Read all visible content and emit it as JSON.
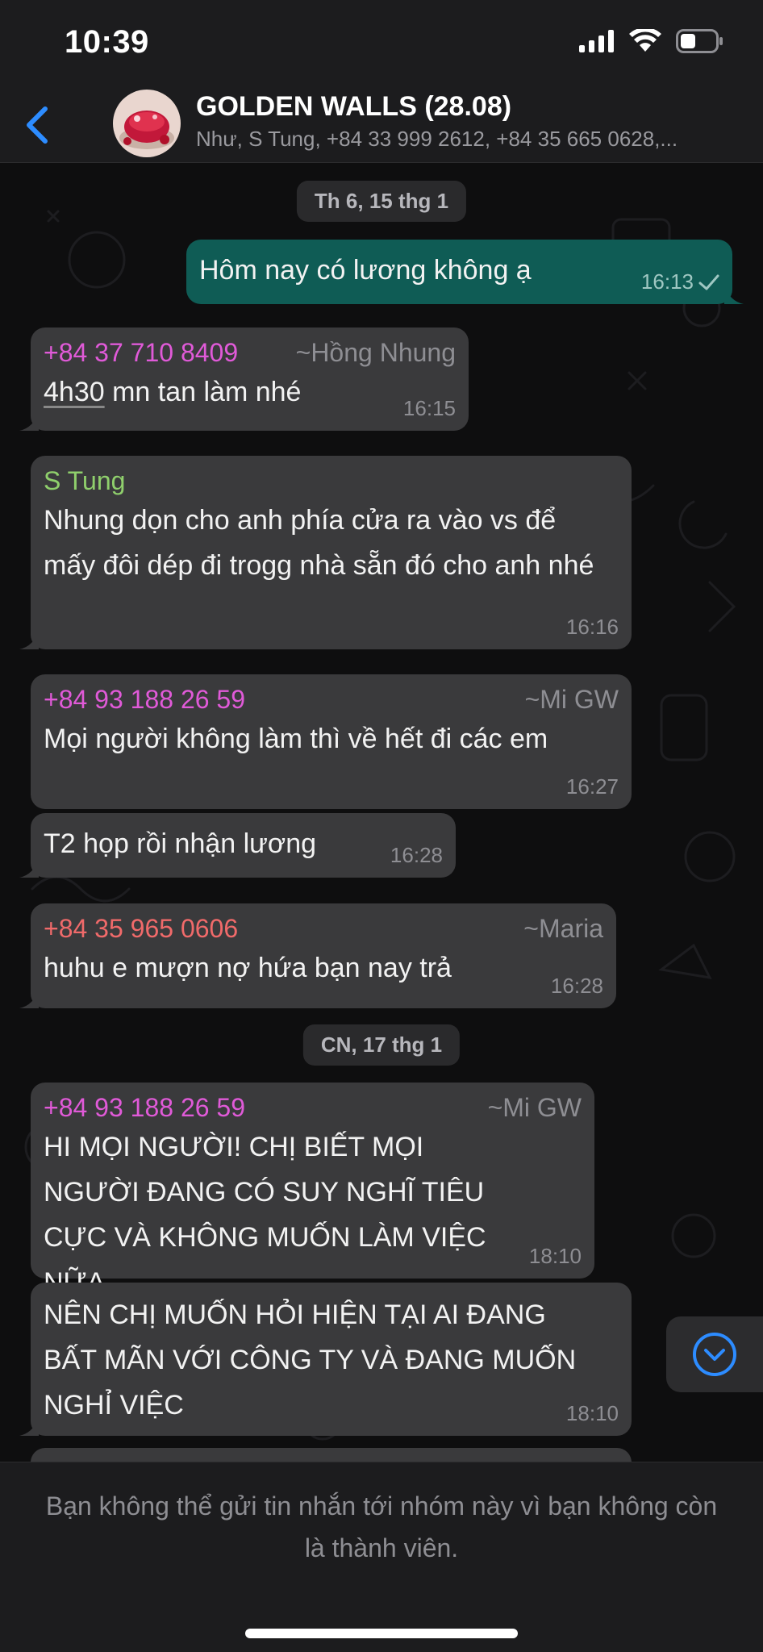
{
  "status_bar": {
    "time": "10:39"
  },
  "header": {
    "title": "GOLDEN WALLS (28.08)",
    "members": "Như, S Tung, +84 33 999 2612, +84 35 665 0628,..."
  },
  "dates": [
    "Th 6, 15 thg 1",
    "CN, 17 thg 1"
  ],
  "messages": [
    {
      "direction": "out",
      "text": "Hôm nay có lương không ạ",
      "time": "16:13",
      "status_icon": "sent-check-icon"
    },
    {
      "direction": "in",
      "sender": "+84 37 710 8409",
      "pushname": "~Hồng Nhung",
      "sender_color": "#e05ad8",
      "text_u": "4h30",
      "text": " mn tan làm nhé",
      "time": "16:15"
    },
    {
      "direction": "in",
      "sender": "S Tung",
      "sender_color": "#8fcf6c",
      "text": "Nhung dọn cho anh phía cửa ra vào vs để mấy đôi dép đi trogg nhà sẵn đó cho anh nhé",
      "time": "16:16"
    },
    {
      "direction": "in",
      "sender": "+84 93 188 26 59",
      "pushname": "~Mi GW",
      "sender_color": "#e05ad8",
      "text": "Mọi người không làm thì về hết đi các em",
      "time": "16:27"
    },
    {
      "direction": "in",
      "text": "T2 họp rồi nhận lương",
      "time": "16:28"
    },
    {
      "direction": "in",
      "sender": "+84 35 965 0606",
      "pushname": "~Maria",
      "sender_color": "#f06a6a",
      "text": "huhu e mượn nợ hứa bạn nay trả",
      "time": "16:28"
    },
    {
      "direction": "in",
      "sender": "+84 93 188 26 59",
      "pushname": "~Mi GW",
      "sender_color": "#e05ad8",
      "text": "HI MỌI NGƯỜI! CHỊ BIẾT MỌI NGƯỜI ĐANG CÓ SUY NGHĨ TIÊU CỰC VÀ KHÔNG MUỐN LÀM VIỆC NỮA.",
      "time": "18:10"
    },
    {
      "direction": "in",
      "text": "NÊN CHỊ MUỐN HỎI HIỆN TẠI AI ĐANG BẤT MÃN VỚI CÔNG TY VÀ ĐANG MUỐN NGHỈ VIỆC",
      "time": "18:10"
    }
  ],
  "footer": {
    "notice": "Bạn không thể gửi tin nhắn tới nhóm này vì bạn không còn là thành viên."
  },
  "colors": {
    "accent": "#2d8cff",
    "outgoing_bubble": "#0f5c55",
    "incoming_bubble": "#3a3a3c"
  }
}
